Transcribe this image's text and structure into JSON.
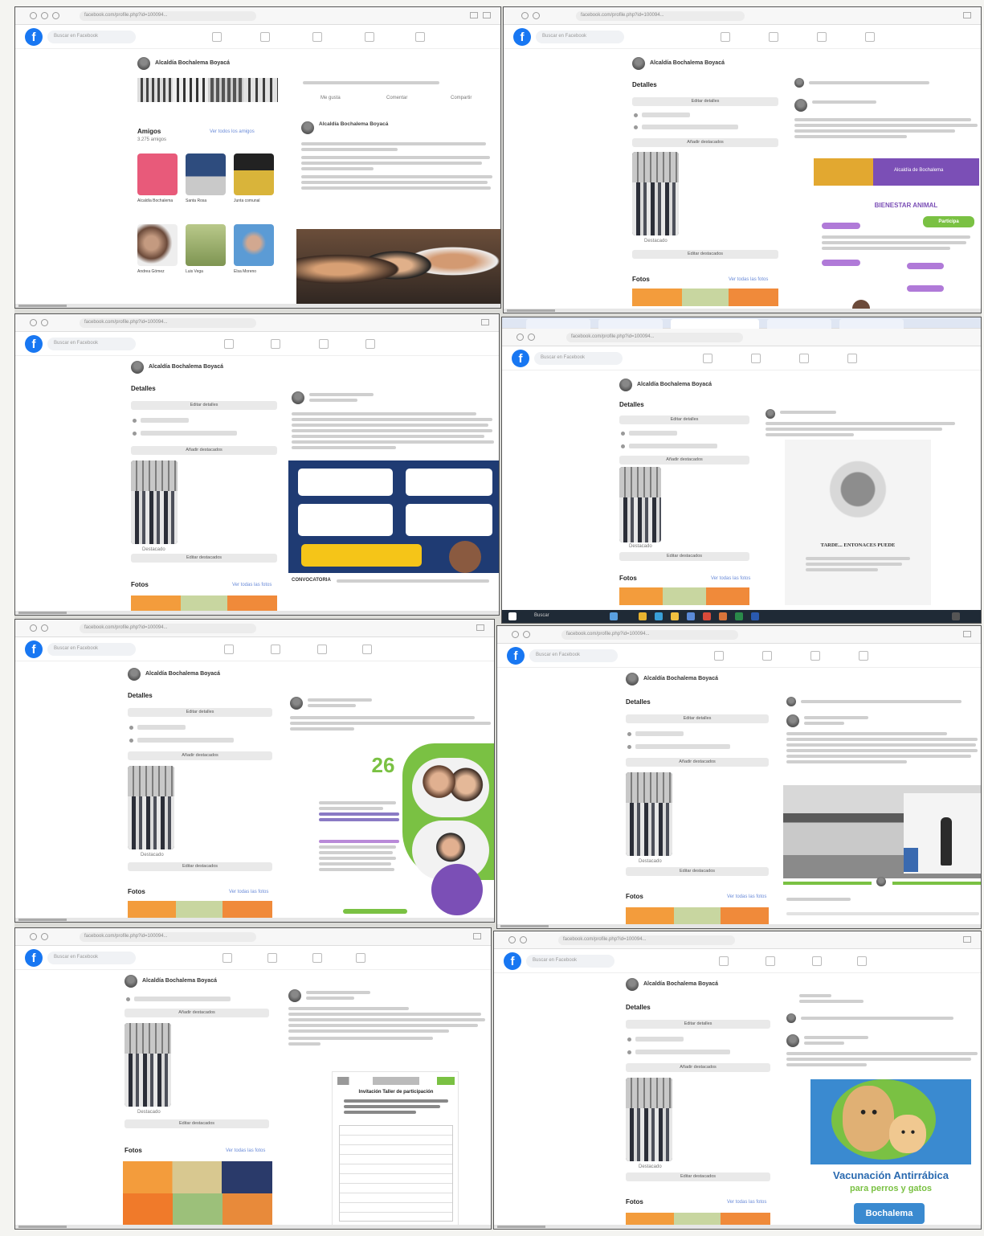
{
  "browser": {
    "address": "facebook.com/profile.php?id=100094..."
  },
  "fb": {
    "logo_letter": "f",
    "search_placeholder": "Buscar en Facebook",
    "profile_name": "Alcaldía Bochalema Boyacá"
  },
  "profile": {
    "intro_title": "Detalles",
    "edit_details": "Editar detalles",
    "add_featured": "Añadir destacados",
    "edit_featured": "Editar destacados",
    "featured_caption": "Destacado",
    "photos_title": "Fotos",
    "see_all_photos": "Ver todas las fotos",
    "friends_title": "Amigos",
    "see_all_friends": "Ver todos los amigos",
    "friends_count": "3.275 amigos"
  },
  "friends": [
    {
      "name": "Alcaldía Bochalema",
      "color": "#e85a7a"
    },
    {
      "name": "Santa Rosa",
      "color": "#4a6fa5"
    },
    {
      "name": "Junta comunal",
      "color": "#d9b43a"
    },
    {
      "name": "Andrea Gómez",
      "color": "#8a6a58"
    },
    {
      "name": "Luis Vega",
      "color": "#9cae6a"
    },
    {
      "name": "Elsa Moreno",
      "color": "#5b9bd5"
    }
  ],
  "posts": {
    "p1_author": "Alcaldía Bochalema Boyacá",
    "p1_actions": [
      "Me gusta",
      "Comentar",
      "Compartir"
    ],
    "p2_headline": "BIENESTAR ANIMAL",
    "p2_banner": "Alcaldía de Bochalema",
    "p2_tag": "Participa",
    "p3_footer": "CONVOCATORIA",
    "p4_headline": "TARDE... ENTONACES PUEDE",
    "p5_number": "26",
    "p7_doc_title": "Invitación Taller de participación",
    "p8_headline": "Vacunación Antirrábica",
    "p8_sub": "para perros y gatos",
    "p8_place": "Bochalema"
  },
  "taskbar": {
    "search": "Buscar"
  },
  "colors": {
    "fb_blue": "#1877f2",
    "orange": "#f39c3c",
    "green": "#7ac143",
    "purple": "#7b4fb6",
    "navy": "#1f3b73"
  }
}
